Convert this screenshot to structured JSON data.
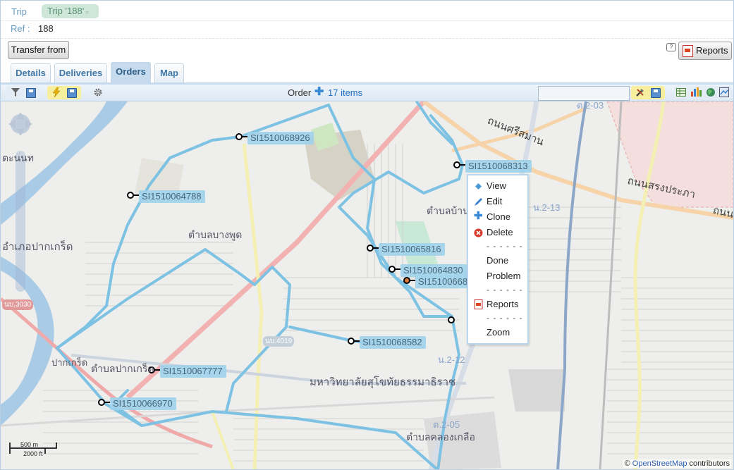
{
  "breadcrumb": {
    "trip": "Trip",
    "current": "Trip '188'"
  },
  "ref": {
    "label": "Ref :",
    "value": "188"
  },
  "buttons": {
    "transfer_from": "Transfer from",
    "reports": "Reports"
  },
  "tabs": [
    {
      "label": "Details",
      "active": false
    },
    {
      "label": "Deliveries",
      "active": false
    },
    {
      "label": "Orders",
      "active": true
    },
    {
      "label": "Map",
      "active": false
    }
  ],
  "toolbar": {
    "order_label": "Order",
    "order_count": "17 items",
    "search_value": "",
    "icons": [
      "filter-icon",
      "save-icon",
      "lightning-icon",
      "save-icon",
      "gear-icon",
      "tools-icon",
      "save-icon",
      "table-icon",
      "chart-icon",
      "globe-icon",
      "map-view-icon"
    ]
  },
  "map": {
    "markers": [
      {
        "label": "SI1510068926"
      },
      {
        "label": "SI1510064788"
      },
      {
        "label": "SI1510068313"
      },
      {
        "label": "SI1510065816"
      },
      {
        "label": "SI1510064830"
      },
      {
        "label": "SI151006683"
      },
      {
        "label": "SI1510068582"
      },
      {
        "label": "SI1510067777"
      },
      {
        "label": "SI1510066970"
      }
    ],
    "places": {
      "amphoe_pak_kret": "อำเภอปากเกร็ด",
      "tambon_bang_phut": "ตำบลบางพูด",
      "tambon_pak_kret": "ตำบลปากเกร็ด",
      "pak_kret": "ปากเกร็ด",
      "university": "มหาวิทยาลัยสุโขทัยธรรมาธิราช",
      "tambon_khlong_kluea": "ตำบลคลองเกลือ",
      "tambon_ban_mai": "ตำบลบ้านใหม่",
      "nonthaburi_fragment": "ตะนนท",
      "road_sri_saman": "ถนนศรีสมาน",
      "road_song_prapha": "ถนนสรงประภา",
      "road_fragment": "ถนน",
      "route_3030": "นบ.3030",
      "route_4019": "นบ.4019",
      "route_2_13": "น.2-13",
      "route_2_12": "น.2-12",
      "route_2_05": "ต.2-05",
      "route_2_03": "ต.2-03"
    },
    "scale": {
      "metric": "500 m",
      "imperial": "2000 ft"
    },
    "attribution": {
      "prefix": "©",
      "link": "OpenStreetMap",
      "suffix": "contributors"
    }
  },
  "context_menu": {
    "items": [
      {
        "label": "View",
        "icon": "view-icon"
      },
      {
        "label": "Edit",
        "icon": "pencil-icon"
      },
      {
        "label": "Clone",
        "icon": "plus-icon"
      },
      {
        "label": "Delete",
        "icon": "delete-icon"
      },
      {
        "label": "Done",
        "icon": ""
      },
      {
        "label": "Problem",
        "icon": ""
      },
      {
        "label": "Reports",
        "icon": "pdf-icon"
      },
      {
        "label": "Zoom",
        "icon": ""
      }
    ],
    "separator": "- - - - - -"
  },
  "colors": {
    "route": "#7ec2e3",
    "tab_active": "#c6dcee",
    "link": "#1f6fc6",
    "marker_label_bg": "#9fd2ec"
  }
}
